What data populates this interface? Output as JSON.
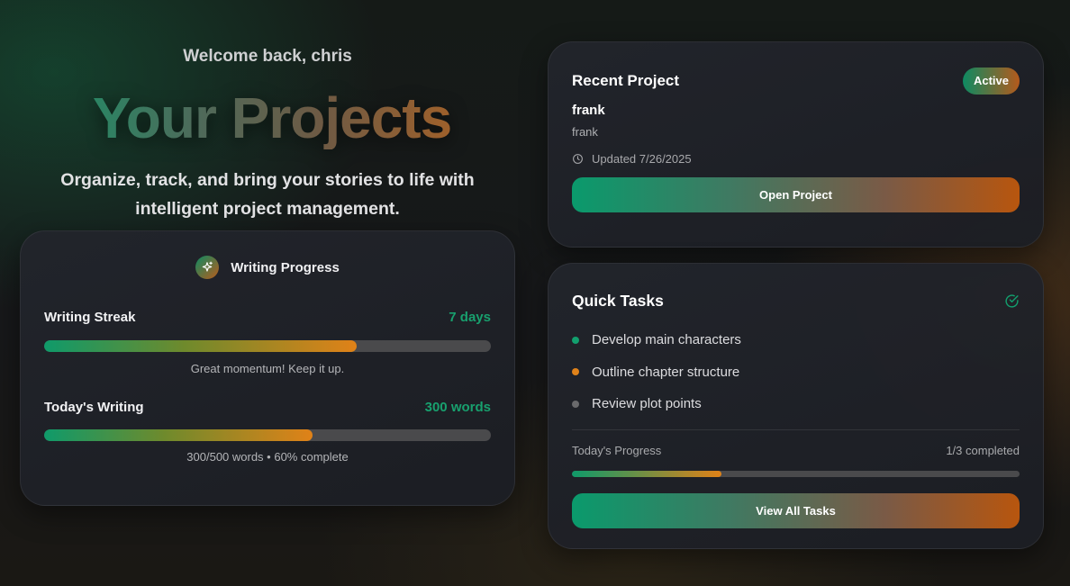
{
  "hero": {
    "welcome": "Welcome back, chris",
    "title": "Your Projects",
    "subtitle_line1": "Organize, track, and bring your stories to life with",
    "subtitle_line2": "intelligent project management."
  },
  "writing_progress": {
    "title": "Writing Progress",
    "icon": "sparkle-icon",
    "streak": {
      "label": "Writing Streak",
      "value": "7 days",
      "progress": 0.7,
      "note": "Great momentum! Keep it up."
    },
    "today": {
      "label": "Today's Writing",
      "value": "300 words",
      "progress": 0.6,
      "note": "300/500 words • 60% complete"
    }
  },
  "recent_project": {
    "title": "Recent Project",
    "badge": "Active",
    "name": "frank",
    "description": "frank",
    "updated": "Updated 7/26/2025",
    "button": "Open Project"
  },
  "quick_tasks": {
    "title": "Quick Tasks",
    "tasks": [
      {
        "label": "Develop main characters",
        "color": "#12a06e"
      },
      {
        "label": "Outline chapter structure",
        "color": "#e0821a"
      },
      {
        "label": "Review plot points",
        "color": "#6a6a6c"
      }
    ],
    "progress_label": "Today's Progress",
    "progress_value": "1/3 completed",
    "progress": 0.333,
    "button": "View All Tasks"
  },
  "colors": {
    "accent_green": "#12a06e",
    "accent_orange": "#e0821a"
  }
}
